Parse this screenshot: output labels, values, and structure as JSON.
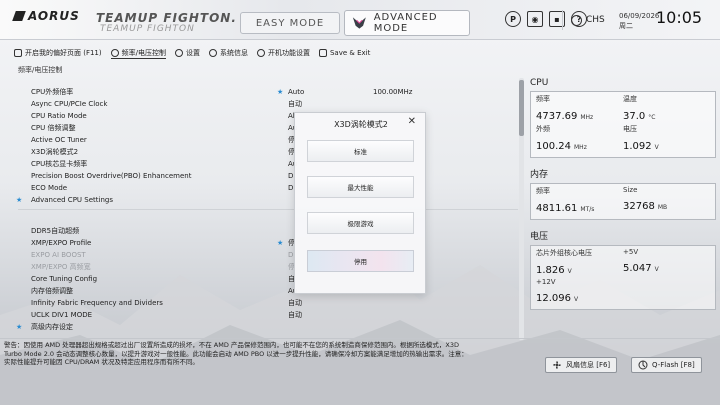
{
  "header": {
    "logo": "AORUS",
    "brand_title": "TEAMUP FIGHTON.",
    "brand_subtitle": "TEAMUP FIGHTON",
    "mode_easy": "EASY MODE",
    "mode_advanced": "ADVANCED MODE",
    "icons": [
      "power-icon",
      "camera-icon",
      "save-icon",
      "help-icon",
      "globe-icon"
    ],
    "language": "CHS",
    "date": "06/09/2026",
    "weekday": "周二",
    "time": "10:05"
  },
  "nav": {
    "items": [
      {
        "label": "开启我的偏好页面 (F11)",
        "icon": "favorites-icon"
      },
      {
        "label": "频率/电压控制",
        "icon": "tweaker-icon",
        "active": true
      },
      {
        "label": "设置",
        "icon": "gear-icon"
      },
      {
        "label": "系统信息",
        "icon": "info-icon"
      },
      {
        "label": "开机功能设置",
        "icon": "boot-icon"
      },
      {
        "label": "Save & Exit",
        "icon": "exit-icon"
      }
    ]
  },
  "breadcrumb": "频率/电压控制",
  "settings": {
    "group1": [
      {
        "label": "CPU外频倍率",
        "value_star": true,
        "value": "Auto",
        "value2": "100.00MHz"
      },
      {
        "label": "Async CPU/PCIe Clock",
        "value": "自动"
      },
      {
        "label": "CPU Ratio Mode",
        "value": "Al"
      },
      {
        "label": "CPU 倍频调整",
        "value": "Au"
      },
      {
        "label": "Active OC Tuner",
        "value": "停"
      },
      {
        "label": "X3D涡轮模式2",
        "value": "停"
      },
      {
        "label": "CPU核芯显卡频率",
        "value": "Au"
      },
      {
        "label": "Precision Boost Overdrive(PBO) Enhancement",
        "value": "Di"
      },
      {
        "label": "ECO Mode",
        "value": "Di"
      },
      {
        "label": "Advanced CPU Settings",
        "star": true,
        "value": ""
      }
    ],
    "group2": [
      {
        "label": "DDR5自动超频",
        "value": ""
      },
      {
        "label": "XMP/EXPO Profile",
        "value_star": true,
        "value": "停"
      },
      {
        "label": "EXPO AI BOOST",
        "value": "Di",
        "disabled": true
      },
      {
        "label": "XMP/EXPO 高频宽",
        "value": "停",
        "disabled": true
      },
      {
        "label": "Core Tuning Config",
        "value": "自"
      },
      {
        "label": "内存倍频调整",
        "value": "Au"
      },
      {
        "label": "Infinity Fabric Frequency and Dividers",
        "value": "自动"
      },
      {
        "label": "UCLK DIV1 MODE",
        "value": "自动"
      },
      {
        "label": "高级内存设定",
        "star": true,
        "value": ""
      }
    ]
  },
  "cpu": {
    "title": "CPU",
    "freq_label": "频率",
    "freq": "4737.69",
    "freq_unit": "MHz",
    "temp_label": "温度",
    "temp": "37.0",
    "temp_unit": "°C",
    "bclk_label": "外频",
    "bclk": "100.24",
    "bclk_unit": "MHz",
    "volt_label": "电压",
    "volt": "1.092",
    "volt_unit": "V"
  },
  "memory": {
    "title": "内存",
    "freq_label": "频率",
    "freq": "4811.61",
    "freq_unit": "MT/s",
    "size_label": "Size",
    "size": "32768",
    "size_unit": "MB"
  },
  "voltage": {
    "title": "电压",
    "chipset_label": "芯片外组核心电压",
    "chipset": "1.826",
    "chipset_unit": "V",
    "p5v_label": "+5V",
    "p5v": "5.047",
    "p5v_unit": "V",
    "p12v_label": "+12V",
    "p12v": "12.096",
    "p12v_unit": "V"
  },
  "warning": "警告：因使用 AMD  处理器超出规格或超过出厂设置所造成的损坏，不在 AMD 产品保修范围内，也可能不在您的系统制造商保修范围内。根据所选模式，X3D Turbo Mode 2.0 会动态调整核心数量，以提升游戏对一般性能。此功能会启动 AMD  PBO 以进一步提升性能，请确保冷却方案能满足增加的热输出需求。注意：实际性能提升可能因 CPU/DRAM  状况及特定应用程序而有所不同。",
  "footer": {
    "fan_label": "风扇信息 [F6]",
    "qflash_label": "Q-Flash [F8]"
  },
  "modal": {
    "title": "X3D涡轮模式2",
    "close": "✕",
    "options": [
      "标准",
      "最大性能",
      "极限游戏",
      "停用"
    ],
    "selected_index": 3
  }
}
